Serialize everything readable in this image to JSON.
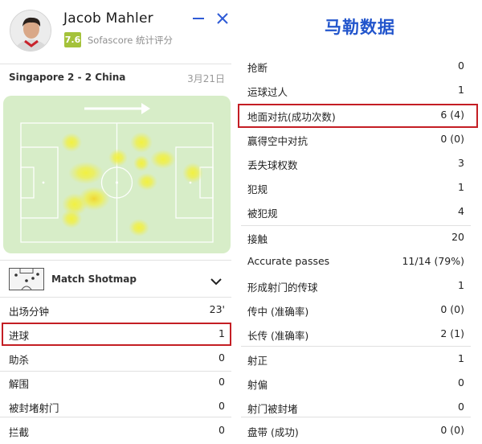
{
  "player": {
    "name": "Jacob Mahler",
    "rating": "7.6",
    "rating_caption": "Sofascore 统计评分"
  },
  "controls": {
    "minimize_icon": "minimize-icon",
    "close_icon": "close-icon"
  },
  "match": {
    "title": "Singapore 2 - 2 China",
    "date": "3月21日"
  },
  "heatmap": {
    "direction_icon": "attack-direction-arrow-icon"
  },
  "shotmap": {
    "label": "Match Shotmap",
    "icon": "goal-net-icon",
    "toggle_icon": "chevron-down-icon"
  },
  "left_stats": [
    {
      "label": "出场分钟",
      "value": "23'"
    },
    {
      "label": "进球",
      "value": "1"
    },
    {
      "label": "助杀",
      "value": "0"
    },
    {
      "label": "解围",
      "value": "0"
    },
    {
      "label": "被封堵射门",
      "value": "0"
    },
    {
      "label": "拦截",
      "value": "0"
    }
  ],
  "right_title": "马勒数据",
  "right_stats": [
    {
      "label": "抢断",
      "value": "0"
    },
    {
      "label": "运球过人",
      "value": "1"
    },
    {
      "label": "地面对抗(成功次数)",
      "value": "6 (4)"
    },
    {
      "label": "赢得空中对抗",
      "value": "0 (0)"
    },
    {
      "label": "丢失球权数",
      "value": "3"
    },
    {
      "label": "犯规",
      "value": "1"
    },
    {
      "label": "被犯规",
      "value": "4"
    },
    {
      "label": "接触",
      "value": "20"
    },
    {
      "label": "Accurate passes",
      "value": "11/14 (79%)"
    },
    {
      "label": "形成射门的传球",
      "value": "1"
    },
    {
      "label": "传中 (准确率)",
      "value": "0 (0)"
    },
    {
      "label": "长传 (准确率)",
      "value": "2 (1)"
    },
    {
      "label": "射正",
      "value": "1"
    },
    {
      "label": "射偏",
      "value": "0"
    },
    {
      "label": "射门被封堵",
      "value": "0"
    },
    {
      "label": "盘带 (成功)",
      "value": "0 (0)"
    }
  ],
  "colors": {
    "highlight": "#c41e24",
    "title_blue": "#2255cc",
    "rating_green": "#a4c23a",
    "pitch": "#d7edc8",
    "heat": "#f3f13a"
  }
}
